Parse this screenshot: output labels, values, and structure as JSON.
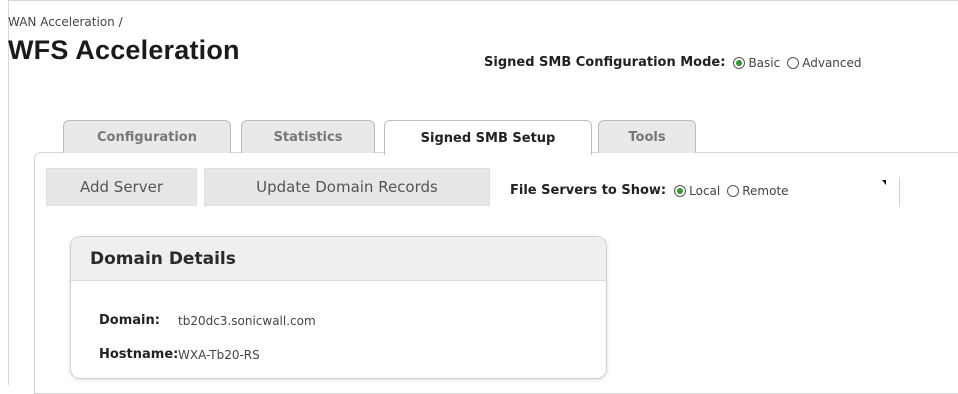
{
  "breadcrumb": "WAN Acceleration /",
  "page_title": "WFS Acceleration",
  "config_mode": {
    "label": "Signed SMB Configuration Mode:",
    "options": [
      {
        "label": "Basic",
        "selected": true
      },
      {
        "label": "Advanced",
        "selected": false
      }
    ]
  },
  "tabs": [
    {
      "label": "Configuration",
      "active": false
    },
    {
      "label": "Statistics",
      "active": false
    },
    {
      "label": "Signed SMB Setup",
      "active": true
    },
    {
      "label": "Tools",
      "active": false
    }
  ],
  "toolbar": {
    "add_server": "Add Server",
    "update_domain_records": "Update Domain Records"
  },
  "file_servers": {
    "label": "File Servers to Show:",
    "options": [
      {
        "label": "Local",
        "selected": true
      },
      {
        "label": "Remote",
        "selected": false
      }
    ]
  },
  "domain_details": {
    "title": "Domain Details",
    "domain_label": "Domain:",
    "domain_value": "tb20dc3.sonicwall.com",
    "hostname_label": "Hostname:",
    "hostname_value": "WXA-Tb20-RS"
  },
  "colors": {
    "radio_selected": "#2a9d2a",
    "tab_inactive_bg": "#e9e9e9",
    "button_bg": "#e7e7e7"
  }
}
